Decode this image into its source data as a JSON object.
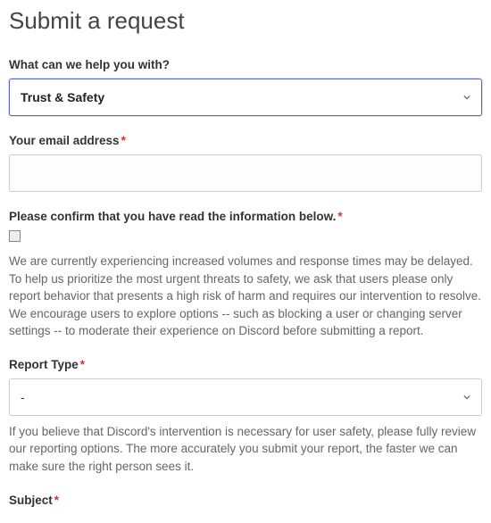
{
  "title": "Submit a request",
  "fields": {
    "topic": {
      "label": "What can we help you with?",
      "required": false,
      "value": "Trust & Safety"
    },
    "email": {
      "label": "Your email address",
      "required": true,
      "value": ""
    },
    "confirm": {
      "label": "Please confirm that you have read the information below.",
      "required": true,
      "checked": false,
      "help": "We are currently experiencing increased volumes and response times may be delayed. To help us prioritize the most urgent threats to safety, we ask that users please only report behavior that presents a high risk of harm and requires our intervention to resolve. We encourage users to explore options -- such as blocking a user or changing server settings -- to moderate their experience on Discord before submitting a report."
    },
    "report_type": {
      "label": "Report Type",
      "required": true,
      "value": "-",
      "help": "If you believe that Discord's intervention is necessary for user safety, please fully review our reporting options. The more accurately you submit your report, the faster we can make sure the right person sees it."
    },
    "subject": {
      "label": "Subject",
      "required": true
    }
  },
  "required_marker": "*"
}
